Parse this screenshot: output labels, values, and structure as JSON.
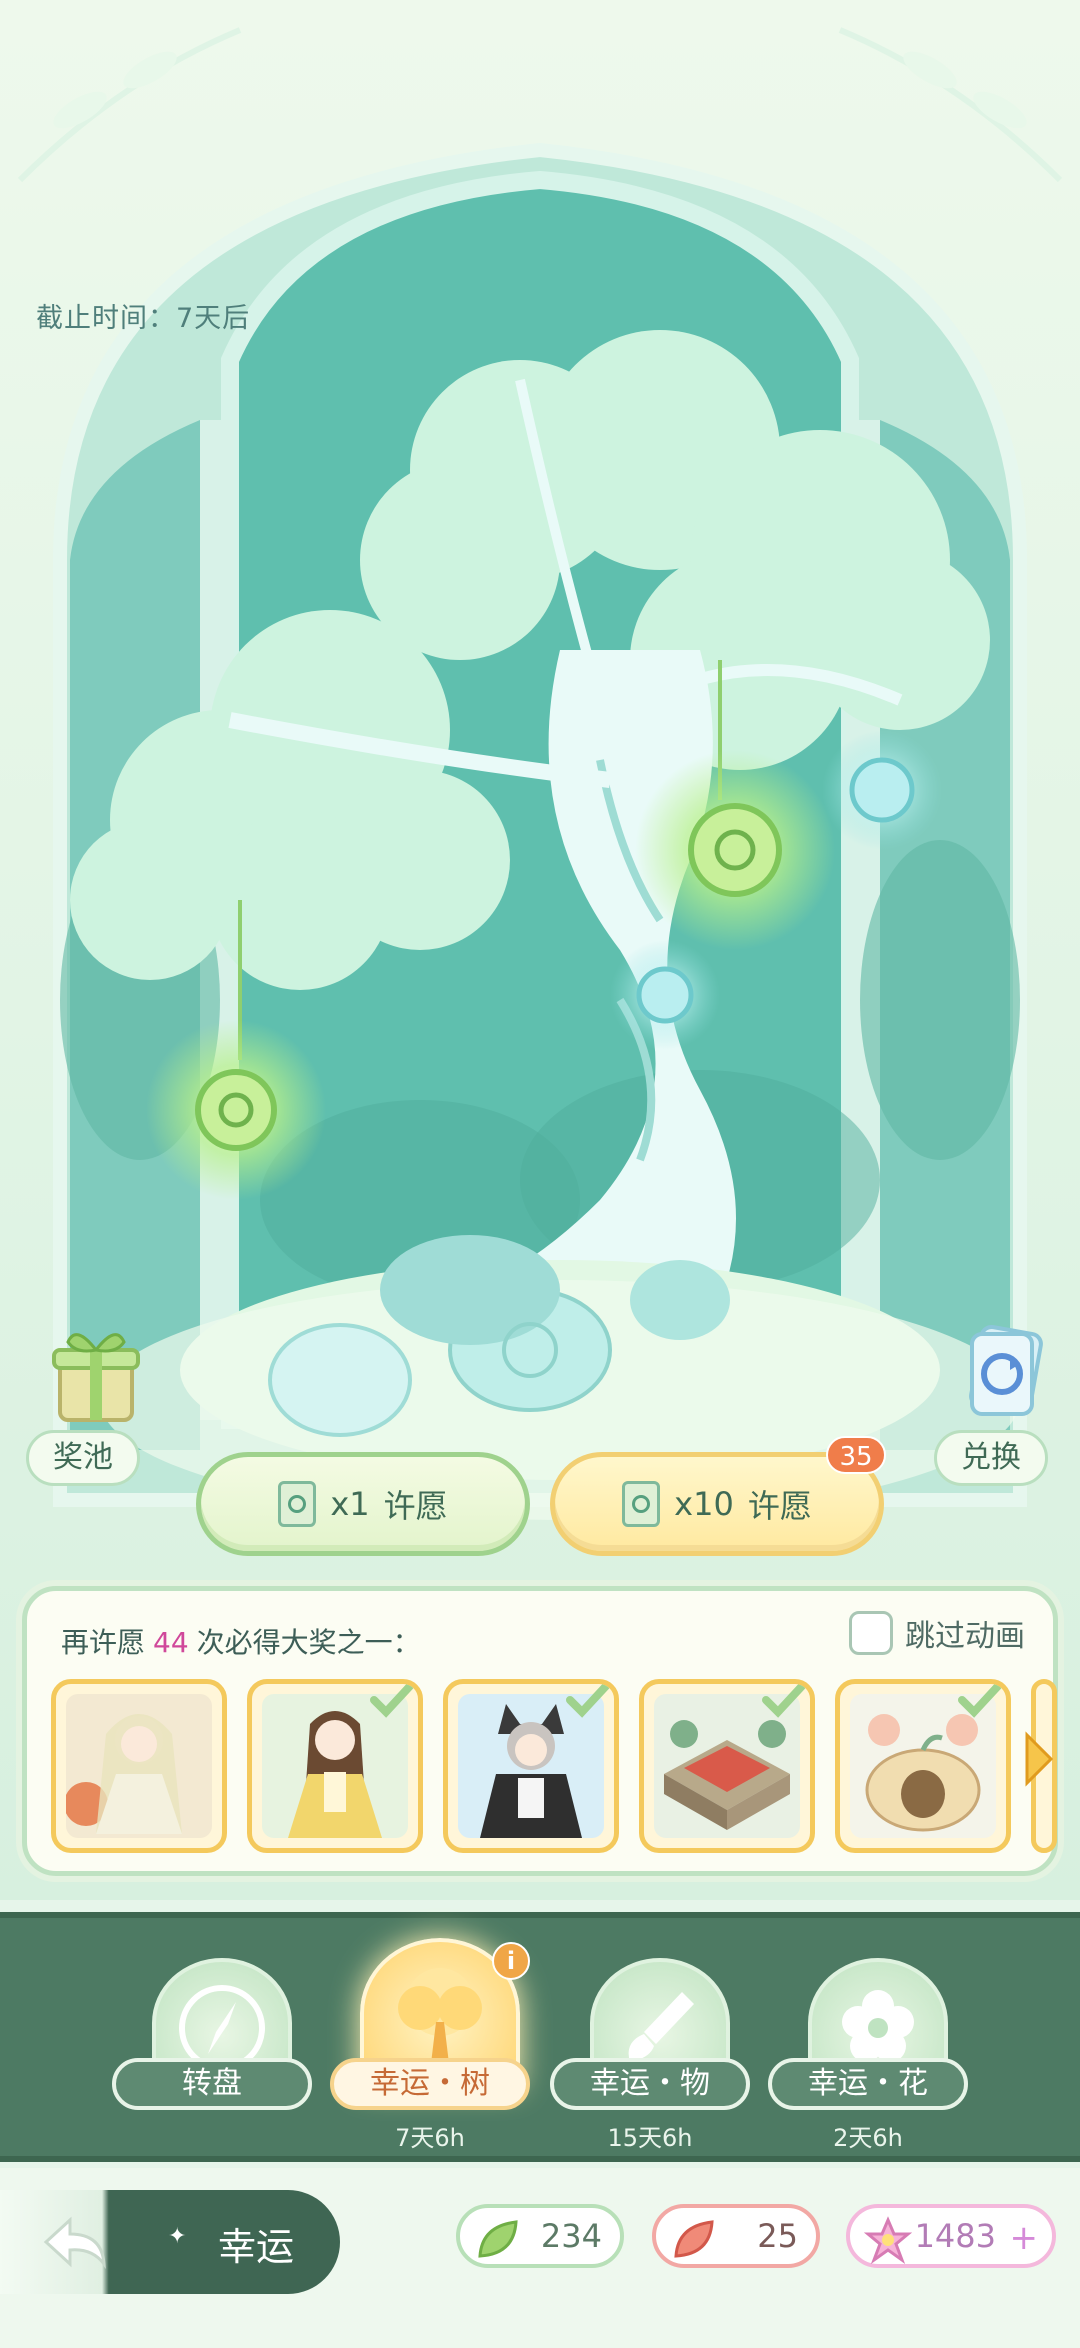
{
  "deadline": {
    "label": "截止时间：",
    "value": "7天后"
  },
  "side_buttons": {
    "prize_pool": "奖池",
    "exchange": "兑换"
  },
  "wish_buttons": {
    "single": {
      "count": "x1",
      "label": "许愿"
    },
    "ten": {
      "count": "x10",
      "label": "许愿",
      "badge": "35"
    }
  },
  "reward_panel": {
    "prefix": "再许愿",
    "remaining": "44",
    "suffix": "次必得大奖之一：",
    "skip_label": "跳过动画",
    "items": [
      {
        "name": "green-dress-girl-card",
        "owned": false
      },
      {
        "name": "yellow-dress-girl-card",
        "owned": true
      },
      {
        "name": "cat-hood-girl-card",
        "owned": true
      },
      {
        "name": "house-building-card",
        "owned": true
      },
      {
        "name": "pumpkin-house-card",
        "owned": true
      }
    ]
  },
  "nav": [
    {
      "name": "转盘",
      "sub": ""
    },
    {
      "name": "幸运・树",
      "sub": "7天6h",
      "active": true
    },
    {
      "name": "幸运・物",
      "sub": "15天6h"
    },
    {
      "name": "幸运・花",
      "sub": "2天6h"
    }
  ],
  "bottom": {
    "back_label": "幸运",
    "currencies": {
      "green_leaf": "234",
      "red_leaf": "25",
      "star": "1483"
    }
  },
  "colors": {
    "accent_gold": "#f4c95c",
    "nav_bg": "#4d7a63",
    "badge": "#f07d4a",
    "remaining": "#d0489a"
  }
}
